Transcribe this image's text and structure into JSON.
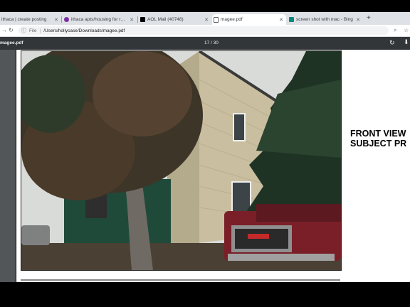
{
  "browser": {
    "tabs": [
      {
        "label": "ithaca | create posting",
        "icon": "craigslist-icon",
        "color": "#9b59b6"
      },
      {
        "label": "ithaca apts/housing for rent \"s",
        "icon": "craigslist-icon",
        "color": "#7b2fa0"
      },
      {
        "label": "AOL Mail (40748)",
        "icon": "aol-icon",
        "color": "#000000"
      },
      {
        "label": "magee.pdf",
        "icon": "document-icon",
        "color": "#5f6368"
      },
      {
        "label": "screen shot with mac - Bing",
        "icon": "bing-icon",
        "color": "#00897b"
      }
    ],
    "active_tab": 3,
    "address": {
      "scheme": "File",
      "path": "/Users/hollycase/Downloads/magee.pdf"
    }
  },
  "pdf_viewer": {
    "title": "magee.pdf",
    "page_indicator": "17 / 30"
  },
  "document": {
    "caption_lines": [
      "FRONT VIEW",
      "SUBJECT PR"
    ]
  }
}
